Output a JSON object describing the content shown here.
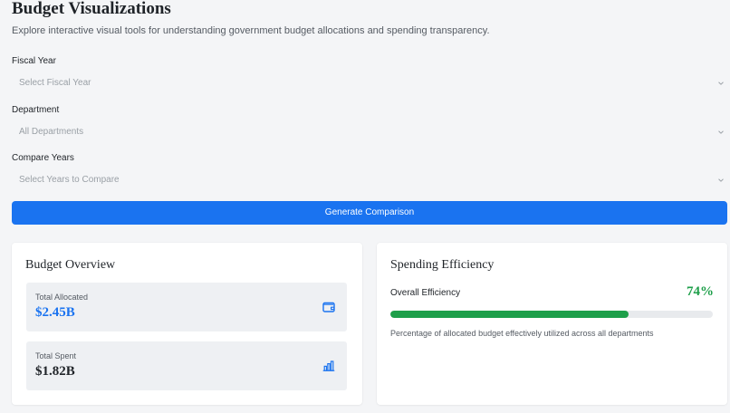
{
  "header": {
    "title": "Budget Visualizations",
    "subtitle": "Explore interactive visual tools for understanding government budget allocations and spending transparency."
  },
  "filters": {
    "fiscal_year": {
      "label": "Fiscal Year",
      "placeholder": "Select Fiscal Year"
    },
    "department": {
      "label": "Department",
      "value": "All Departments"
    },
    "compare_years": {
      "label": "Compare Years",
      "placeholder": "Select Years to Compare"
    }
  },
  "actions": {
    "generate_label": "Generate Comparison"
  },
  "overview": {
    "title": "Budget Overview",
    "total_allocated": {
      "label": "Total Allocated",
      "value": "$2.45B",
      "icon": "wallet-icon",
      "color": "#1a73f0"
    },
    "total_spent": {
      "label": "Total Spent",
      "value": "$1.82B",
      "icon": "bar-chart-icon",
      "color": "#1f2328"
    }
  },
  "efficiency": {
    "title": "Spending Efficiency",
    "label": "Overall Efficiency",
    "value": "74%",
    "progress": 0.74,
    "description": "Percentage of allocated budget effectively utilized across all departments",
    "color": "#1e9f4a"
  },
  "colors": {
    "primary": "#1a73f0",
    "success": "#1e9f4a",
    "background": "#f4f5f7",
    "card": "#ffffff"
  }
}
